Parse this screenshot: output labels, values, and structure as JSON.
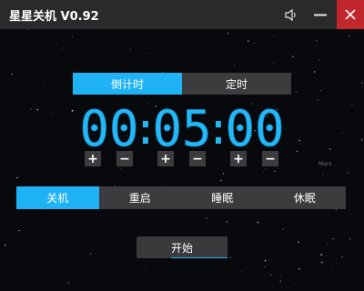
{
  "window": {
    "title": "星星关机 V0.92",
    "accent": "#1fb3f5",
    "close_color": "#c1272d"
  },
  "titlebar": {
    "icons": [
      "speaker-icon",
      "minimize-icon",
      "close-icon"
    ]
  },
  "tabs": [
    {
      "label": "倒计时",
      "active": true
    },
    {
      "label": "定时",
      "active": false
    }
  ],
  "timer": {
    "hours": "00",
    "minutes": "05",
    "seconds": "00",
    "separator": ":"
  },
  "adjust": {
    "plus_label": "+",
    "minus_label": "−"
  },
  "brand": "Mars",
  "modes": [
    {
      "label": "关机",
      "active": true
    },
    {
      "label": "重启",
      "active": false
    },
    {
      "label": "睡眠",
      "active": false
    },
    {
      "label": "休眠",
      "active": false
    }
  ],
  "start_label": "开始"
}
